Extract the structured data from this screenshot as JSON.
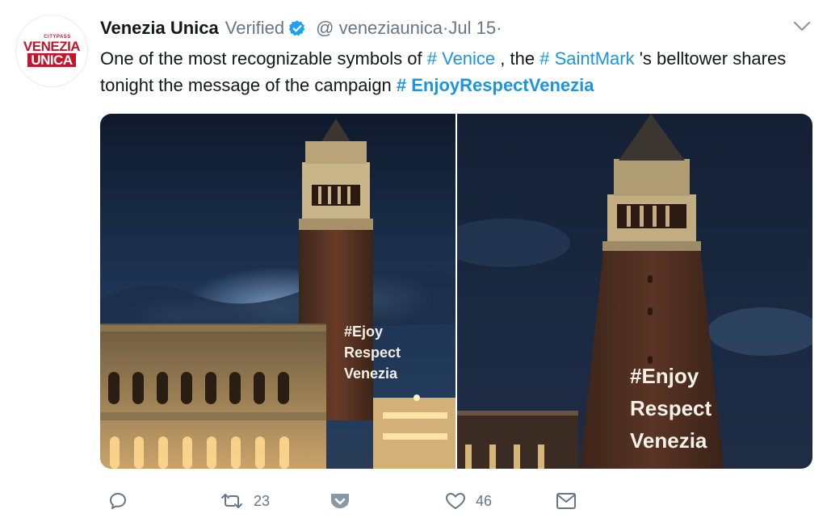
{
  "tweet": {
    "avatar": {
      "citypass": "CITYPASS",
      "line1": "VENEZIA",
      "line2": "UNICA"
    },
    "author_name": "Venezia Unica",
    "verified_label": "Verified",
    "handle": "@ veneziaunica",
    "separator": "·",
    "date": "Jul 15",
    "text": {
      "part1": "One of the most recognizable symbols of ",
      "hashtag1": "# Venice",
      "part2": " , the ",
      "hashtag2": "# SaintMark",
      "part3": " 's belltower shares tonight the message of the campaign ",
      "hashtag3": "# EnjoyRespectVenezia"
    },
    "media": {
      "left_projection": [
        "#Ejoy",
        "Respect",
        "Venezia"
      ],
      "right_projection": [
        "#Enjoy",
        "Respect",
        "Venezia"
      ]
    },
    "actions": {
      "reply_icon": "reply-icon",
      "retweet_icon": "retweet-icon",
      "retweet_count": "23",
      "pocket_icon": "pocket-icon",
      "like_icon": "heart-icon",
      "like_count": "46",
      "message_icon": "envelope-icon"
    }
  },
  "colors": {
    "link": "#1b95e0",
    "secondary_text": "#657786",
    "verified": "#1da1f2",
    "brand_red": "#c0172b"
  }
}
